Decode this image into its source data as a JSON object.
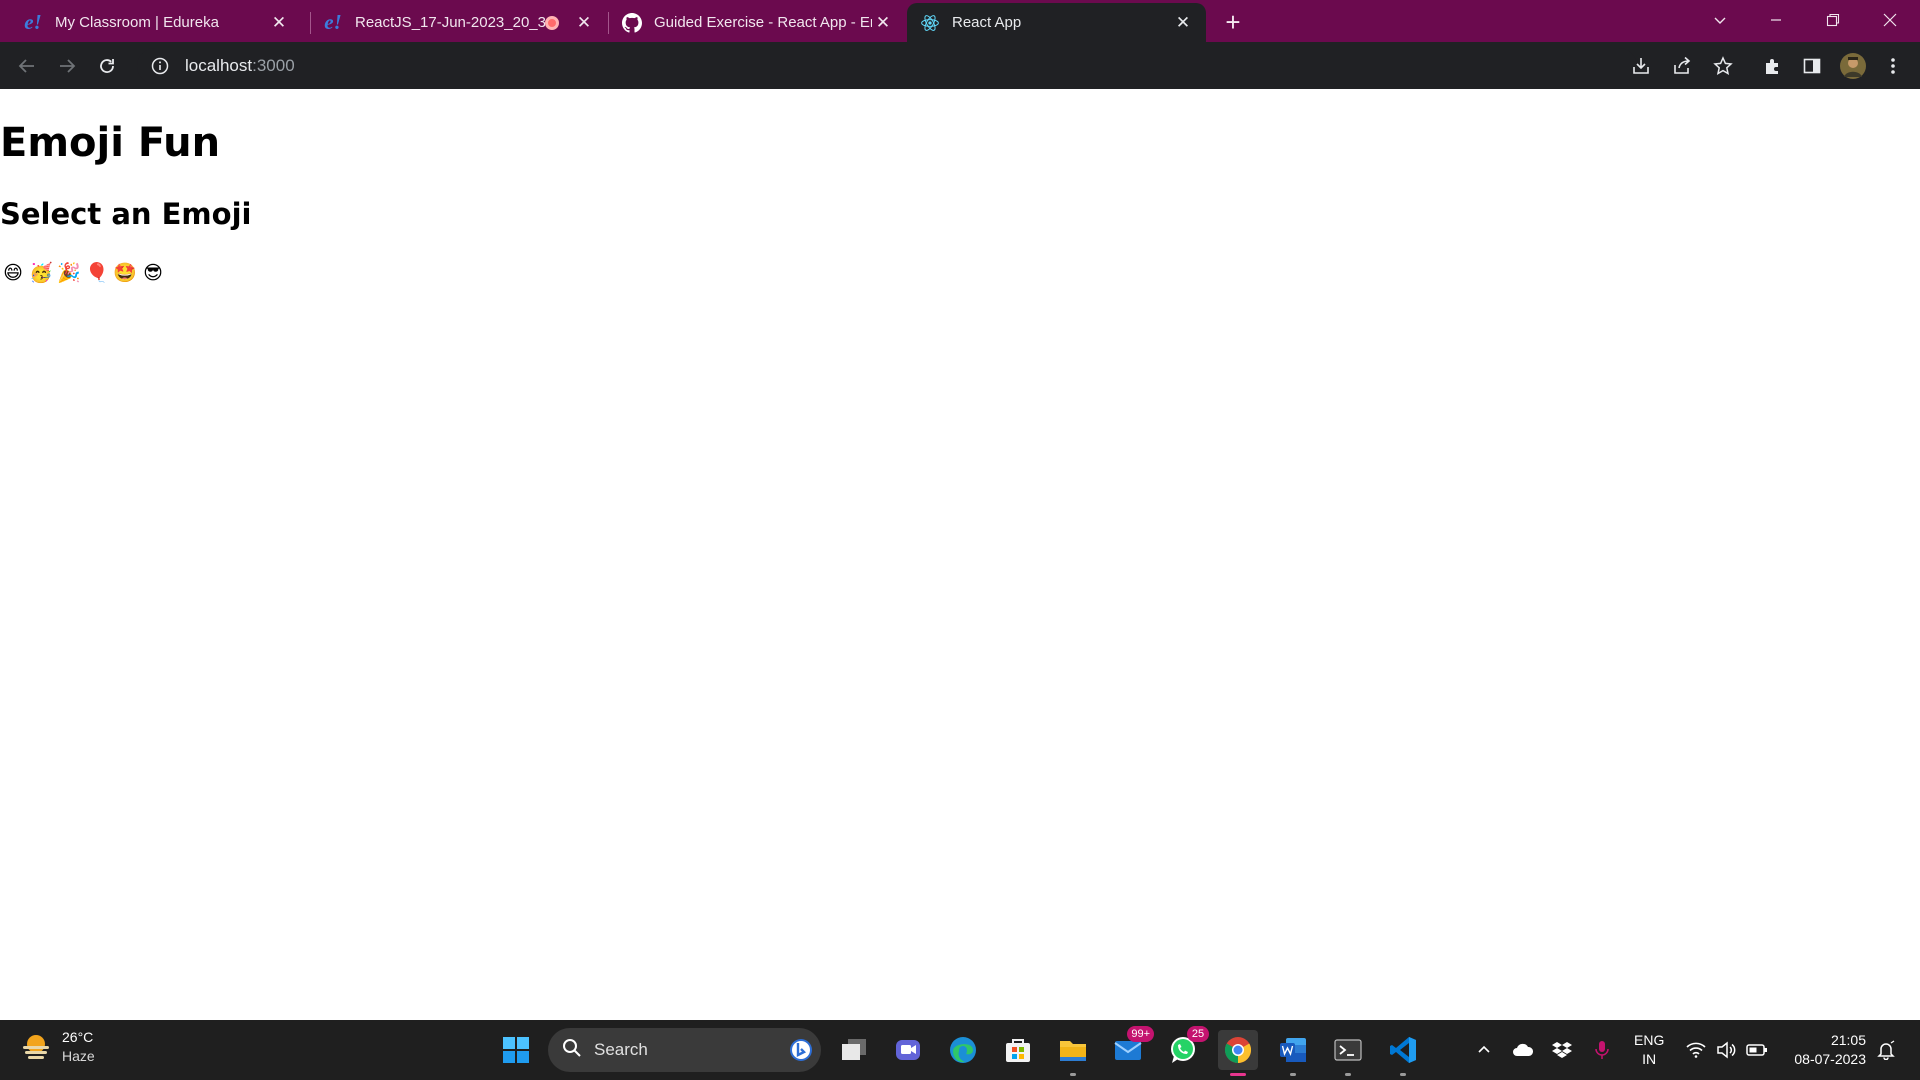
{
  "browser": {
    "tabs": [
      {
        "title": "My Classroom | Edureka",
        "favicon": "edureka-logo",
        "favicon_text": "e!"
      },
      {
        "title": "ReactJS_17-Jun-2023_20_30",
        "favicon": "edureka-logo",
        "favicon_text": "e!",
        "recording": true
      },
      {
        "title": "Guided Exercise - React App - Em",
        "favicon": "github-icon"
      },
      {
        "title": "React App",
        "favicon": "react-icon",
        "active": true
      }
    ],
    "address": {
      "host": "localhost",
      "port": ":3000"
    }
  },
  "page": {
    "title": "Emoji Fun",
    "subtitle": "Select an Emoji",
    "emojis": [
      "😄",
      "🥳",
      "🎉",
      "🎈",
      "🤩",
      "😎"
    ]
  },
  "taskbar": {
    "weather": {
      "temp": "26°C",
      "desc": "Haze"
    },
    "search_label": "Search",
    "mail_badge": "99+",
    "whatsapp_badge": "25",
    "language": {
      "line1": "ENG",
      "line2": "IN"
    },
    "clock": {
      "time": "21:05",
      "date": "08-07-2023"
    }
  },
  "colors": {
    "tabstrip": "#6b0a4e",
    "toolbar": "#202124",
    "taskbar": "#1f1f1f"
  }
}
